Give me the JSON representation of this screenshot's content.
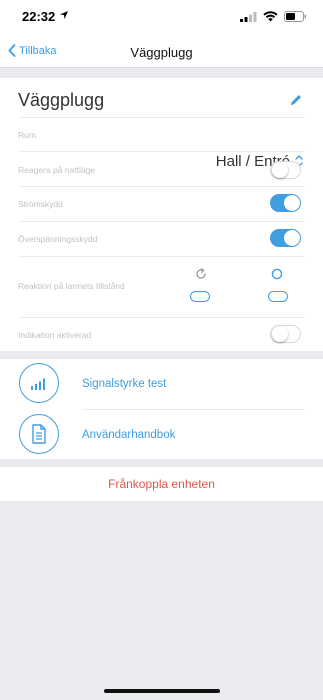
{
  "status_bar": {
    "time": "22:32"
  },
  "nav": {
    "back_label": "Tillbaka",
    "title": "Väggplugg"
  },
  "device": {
    "name": "Väggplugg",
    "room_label": "Rum",
    "room_value": "Hall / Entré",
    "settings": [
      {
        "label": "Reagera på nattläge",
        "enabled": false
      },
      {
        "label": "Strömskydd",
        "enabled": true
      },
      {
        "label": "Överspänningsskydd",
        "enabled": true
      }
    ],
    "alarm_reaction_label": "Reaktion på larmets tillstånd",
    "indication_label": "Indikation aktiverad",
    "indication_enabled": false
  },
  "actions": [
    {
      "label": "Signalstyrke test",
      "icon": "signal-bars-icon"
    },
    {
      "label": "Användarhandbok",
      "icon": "document-icon"
    }
  ],
  "disconnect_label": "Frånkoppla enheten",
  "colors": {
    "accent": "#3f9de0",
    "danger": "#e0554d",
    "background": "#ebebef"
  }
}
